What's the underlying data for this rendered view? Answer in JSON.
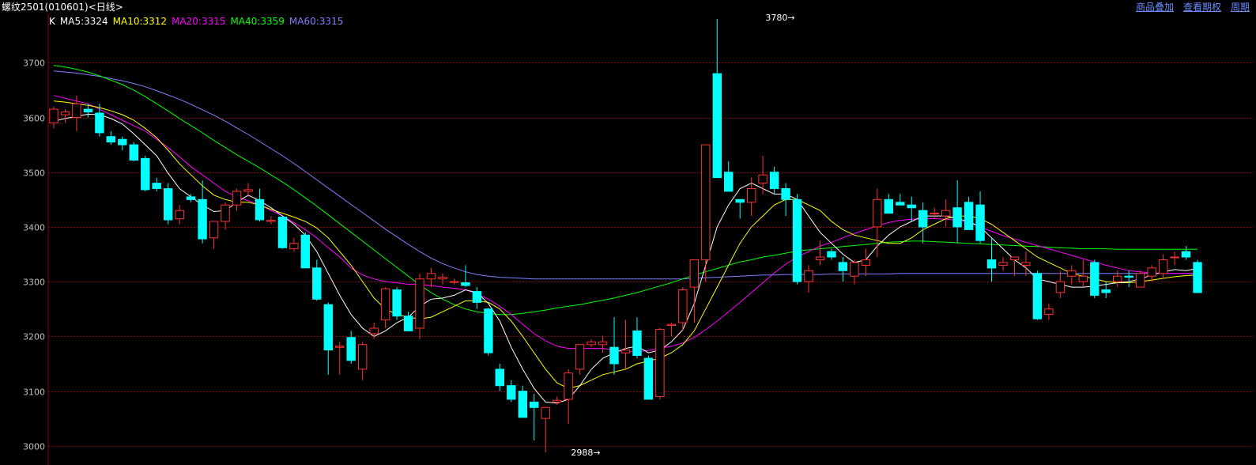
{
  "header": {
    "title": "螺纹2501(010601)<日线>",
    "links": [
      "商品叠加",
      "查看期权",
      "周期"
    ]
  },
  "legend": {
    "k_label": "K",
    "ma5": "MA5:3324",
    "ma10": "MA10:3312",
    "ma20": "MA20:3315",
    "ma40": "MA40:3359",
    "ma60": "MA60:3315"
  },
  "colors": {
    "up": "#ff3232",
    "down": "#00ffff",
    "ma5": "#ffffff",
    "ma10": "#ffff00",
    "ma20": "#ff00ff",
    "ma40": "#00ff00",
    "ma60": "#8080ff",
    "grid": "#8b0000",
    "axis_text": "#c0c0c0"
  },
  "chart_data": {
    "type": "candlestick",
    "ylim": [
      2965,
      3790
    ],
    "yticks": [
      3000,
      3100,
      3200,
      3300,
      3400,
      3500,
      3600,
      3700
    ],
    "grid": true,
    "annotations": [
      {
        "label": "3780→",
        "bar": 65,
        "value": 3780,
        "kind": "high"
      },
      {
        "label": "2988→",
        "bar": 48,
        "value": 2988,
        "kind": "low"
      }
    ],
    "candles": [
      [
        3590,
        3620,
        3580,
        3615
      ],
      [
        3605,
        3615,
        3590,
        3610
      ],
      [
        3600,
        3640,
        3575,
        3625
      ],
      [
        3615,
        3625,
        3600,
        3610
      ],
      [
        3608,
        3625,
        3565,
        3572
      ],
      [
        3565,
        3575,
        3550,
        3555
      ],
      [
        3560,
        3565,
        3540,
        3550
      ],
      [
        3550,
        3555,
        3520,
        3522
      ],
      [
        3525,
        3530,
        3465,
        3468
      ],
      [
        3480,
        3490,
        3465,
        3470
      ],
      [
        3470,
        3480,
        3405,
        3413
      ],
      [
        3415,
        3440,
        3405,
        3430
      ],
      [
        3455,
        3460,
        3445,
        3450
      ],
      [
        3450,
        3485,
        3370,
        3378
      ],
      [
        3380,
        3410,
        3360,
        3410
      ],
      [
        3410,
        3445,
        3395,
        3440
      ],
      [
        3440,
        3470,
        3430,
        3465
      ],
      [
        3465,
        3480,
        3455,
        3468
      ],
      [
        3450,
        3470,
        3410,
        3413
      ],
      [
        3410,
        3420,
        3405,
        3412
      ],
      [
        3418,
        3420,
        3360,
        3362
      ],
      [
        3360,
        3380,
        3355,
        3370
      ],
      [
        3385,
        3390,
        3325,
        3325
      ],
      [
        3325,
        3340,
        3265,
        3268
      ],
      [
        3258,
        3262,
        3130,
        3175
      ],
      [
        3180,
        3190,
        3130,
        3182
      ],
      [
        3198,
        3210,
        3150,
        3156
      ],
      [
        3140,
        3190,
        3120,
        3185
      ],
      [
        3205,
        3225,
        3195,
        3215
      ],
      [
        3230,
        3290,
        3215,
        3287
      ],
      [
        3285,
        3290,
        3230,
        3237
      ],
      [
        3237,
        3245,
        3210,
        3210
      ],
      [
        3215,
        3315,
        3195,
        3305
      ],
      [
        3305,
        3325,
        3290,
        3315
      ],
      [
        3305,
        3315,
        3295,
        3308
      ],
      [
        3300,
        3305,
        3295,
        3300
      ],
      [
        3298,
        3330,
        3290,
        3293
      ],
      [
        3282,
        3290,
        3250,
        3262
      ],
      [
        3250,
        3252,
        3165,
        3170
      ],
      [
        3140,
        3150,
        3100,
        3110
      ],
      [
        3110,
        3120,
        3080,
        3085
      ],
      [
        3100,
        3110,
        3055,
        3052
      ],
      [
        3080,
        3095,
        3010,
        3070
      ],
      [
        3050,
        3070,
        2988,
        3070
      ],
      [
        3080,
        3090,
        3075,
        3083
      ],
      [
        3085,
        3140,
        3040,
        3133
      ],
      [
        3140,
        3185,
        3130,
        3185
      ],
      [
        3185,
        3195,
        3180,
        3190
      ],
      [
        3185,
        3200,
        3170,
        3190
      ],
      [
        3180,
        3235,
        3130,
        3150
      ],
      [
        3170,
        3230,
        3140,
        3175
      ],
      [
        3210,
        3235,
        3160,
        3165
      ],
      [
        3160,
        3165,
        3085,
        3085
      ],
      [
        3090,
        3215,
        3085,
        3213
      ],
      [
        3220,
        3225,
        3200,
        3222
      ],
      [
        3225,
        3290,
        3210,
        3285
      ],
      [
        3290,
        3330,
        3225,
        3340
      ],
      [
        3340,
        3550,
        3300,
        3550
      ],
      [
        3680,
        3780,
        3490,
        3490
      ],
      [
        3500,
        3520,
        3465,
        3465
      ],
      [
        3450,
        3445,
        3415,
        3445
      ],
      [
        3445,
        3490,
        3420,
        3470
      ],
      [
        3480,
        3530,
        3460,
        3495
      ],
      [
        3500,
        3510,
        3460,
        3470
      ],
      [
        3470,
        3480,
        3420,
        3450
      ],
      [
        3450,
        3460,
        3295,
        3300
      ],
      [
        3300,
        3330,
        3280,
        3320
      ],
      [
        3340,
        3375,
        3330,
        3345
      ],
      [
        3355,
        3360,
        3340,
        3345
      ],
      [
        3335,
        3345,
        3300,
        3320
      ],
      [
        3310,
        3340,
        3295,
        3335
      ],
      [
        3330,
        3360,
        3310,
        3340
      ],
      [
        3400,
        3470,
        3345,
        3450
      ],
      [
        3450,
        3460,
        3425,
        3425
      ],
      [
        3445,
        3460,
        3440,
        3440
      ],
      [
        3440,
        3455,
        3410,
        3435
      ],
      [
        3430,
        3445,
        3370,
        3400
      ],
      [
        3425,
        3435,
        3415,
        3425
      ],
      [
        3420,
        3450,
        3400,
        3430
      ],
      [
        3435,
        3485,
        3370,
        3400
      ],
      [
        3445,
        3455,
        3395,
        3395
      ],
      [
        3440,
        3465,
        3370,
        3375
      ],
      [
        3340,
        3380,
        3300,
        3325
      ],
      [
        3330,
        3345,
        3320,
        3335
      ],
      [
        3340,
        3345,
        3310,
        3345
      ],
      [
        3330,
        3355,
        3310,
        3335
      ],
      [
        3315,
        3320,
        3230,
        3232
      ],
      [
        3240,
        3260,
        3230,
        3250
      ],
      [
        3280,
        3320,
        3270,
        3300
      ],
      [
        3310,
        3330,
        3295,
        3320
      ],
      [
        3300,
        3340,
        3290,
        3310
      ],
      [
        3335,
        3340,
        3270,
        3275
      ],
      [
        3285,
        3300,
        3270,
        3280
      ],
      [
        3300,
        3320,
        3290,
        3310
      ],
      [
        3310,
        3320,
        3290,
        3308
      ],
      [
        3290,
        3320,
        3290,
        3315
      ],
      [
        3310,
        3330,
        3300,
        3325
      ],
      [
        3315,
        3350,
        3305,
        3340
      ],
      [
        3345,
        3355,
        3330,
        3345
      ],
      [
        3355,
        3365,
        3340,
        3345
      ],
      [
        3335,
        3340,
        3285,
        3280
      ]
    ],
    "ma": {
      "ma5": [
        3593,
        3598,
        3602,
        3606,
        3605,
        3598,
        3588,
        3570,
        3550,
        3530,
        3498,
        3470,
        3455,
        3440,
        3428,
        3430,
        3445,
        3458,
        3448,
        3435,
        3420,
        3405,
        3385,
        3355,
        3315,
        3275,
        3240,
        3215,
        3200,
        3210,
        3225,
        3235,
        3255,
        3268,
        3270,
        3275,
        3285,
        3280,
        3260,
        3228,
        3180,
        3140,
        3105,
        3080,
        3078,
        3085,
        3110,
        3140,
        3160,
        3170,
        3178,
        3182,
        3170,
        3175,
        3190,
        3212,
        3260,
        3330,
        3400,
        3440,
        3470,
        3480,
        3470,
        3460,
        3460,
        3450,
        3420,
        3390,
        3370,
        3350,
        3335,
        3340,
        3365,
        3385,
        3400,
        3410,
        3420,
        3420,
        3420,
        3415,
        3410,
        3400,
        3380,
        3360,
        3340,
        3325,
        3305,
        3300,
        3295,
        3290,
        3290,
        3292,
        3295,
        3298,
        3300,
        3305,
        3312,
        3318,
        3322,
        3320,
        3324
      ],
      "ma10": [
        3630,
        3628,
        3625,
        3622,
        3618,
        3612,
        3605,
        3595,
        3580,
        3563,
        3540,
        3515,
        3495,
        3475,
        3458,
        3450,
        3445,
        3445,
        3440,
        3432,
        3425,
        3418,
        3410,
        3398,
        3380,
        3355,
        3330,
        3300,
        3270,
        3250,
        3240,
        3235,
        3232,
        3235,
        3245,
        3255,
        3265,
        3265,
        3262,
        3250,
        3228,
        3200,
        3170,
        3140,
        3115,
        3105,
        3110,
        3120,
        3130,
        3135,
        3140,
        3150,
        3155,
        3160,
        3170,
        3185,
        3210,
        3250,
        3290,
        3330,
        3370,
        3400,
        3420,
        3440,
        3450,
        3450,
        3440,
        3430,
        3410,
        3395,
        3385,
        3380,
        3375,
        3370,
        3370,
        3380,
        3395,
        3405,
        3415,
        3420,
        3420,
        3415,
        3405,
        3390,
        3375,
        3360,
        3345,
        3335,
        3325,
        3315,
        3310,
        3305,
        3300,
        3298,
        3298,
        3300,
        3303,
        3306,
        3309,
        3311,
        3312
      ],
      "ma20": [
        3640,
        3635,
        3630,
        3625,
        3615,
        3605,
        3595,
        3585,
        3575,
        3560,
        3545,
        3528,
        3510,
        3495,
        3480,
        3465,
        3455,
        3448,
        3440,
        3430,
        3420,
        3408,
        3395,
        3380,
        3362,
        3345,
        3325,
        3312,
        3305,
        3300,
        3298,
        3295,
        3295,
        3293,
        3290,
        3288,
        3285,
        3278,
        3268,
        3255,
        3240,
        3222,
        3205,
        3192,
        3182,
        3178,
        3178,
        3178,
        3178,
        3175,
        3172,
        3172,
        3174,
        3178,
        3182,
        3188,
        3198,
        3212,
        3228,
        3245,
        3262,
        3280,
        3298,
        3316,
        3332,
        3345,
        3355,
        3365,
        3372,
        3380,
        3388,
        3395,
        3402,
        3408,
        3412,
        3414,
        3415,
        3415,
        3414,
        3412,
        3408,
        3400,
        3392,
        3384,
        3378,
        3372,
        3366,
        3360,
        3354,
        3348,
        3342,
        3336,
        3330,
        3325,
        3320,
        3318,
        3316,
        3315,
        3315,
        3315,
        3315
      ],
      "ma40": [
        3695,
        3692,
        3688,
        3683,
        3676,
        3668,
        3660,
        3650,
        3638,
        3625,
        3612,
        3598,
        3585,
        3572,
        3558,
        3545,
        3532,
        3520,
        3508,
        3495,
        3482,
        3468,
        3453,
        3438,
        3422,
        3406,
        3390,
        3374,
        3358,
        3342,
        3326,
        3310,
        3294,
        3280,
        3268,
        3258,
        3250,
        3245,
        3242,
        3240,
        3240,
        3242,
        3245,
        3248,
        3252,
        3255,
        3258,
        3262,
        3266,
        3270,
        3275,
        3280,
        3286,
        3292,
        3298,
        3305,
        3312,
        3318,
        3324,
        3330,
        3336,
        3340,
        3345,
        3348,
        3352,
        3356,
        3358,
        3360,
        3362,
        3364,
        3366,
        3368,
        3370,
        3372,
        3373,
        3374,
        3374,
        3373,
        3372,
        3371,
        3370,
        3369,
        3368,
        3367,
        3366,
        3365,
        3364,
        3363,
        3362,
        3361,
        3360,
        3360,
        3360,
        3359,
        3359,
        3359,
        3359,
        3359,
        3359,
        3359,
        3359
      ],
      "ma60": [
        3685,
        3683,
        3681,
        3678,
        3675,
        3671,
        3667,
        3662,
        3656,
        3649,
        3641,
        3633,
        3624,
        3614,
        3604,
        3593,
        3581,
        3569,
        3556,
        3543,
        3530,
        3516,
        3501,
        3486,
        3471,
        3456,
        3441,
        3426,
        3411,
        3396,
        3382,
        3368,
        3355,
        3343,
        3333,
        3325,
        3318,
        3313,
        3310,
        3308,
        3307,
        3306,
        3305,
        3305,
        3305,
        3305,
        3305,
        3305,
        3305,
        3305,
        3305,
        3305,
        3305,
        3305,
        3305,
        3305,
        3306,
        3307,
        3308,
        3309,
        3310,
        3311,
        3312,
        3312,
        3313,
        3313,
        3313,
        3313,
        3314,
        3314,
        3314,
        3314,
        3314,
        3314,
        3315,
        3315,
        3315,
        3315,
        3315,
        3315,
        3315,
        3315,
        3315,
        3315,
        3315,
        3315,
        3315,
        3315,
        3315,
        3315,
        3315,
        3315,
        3315,
        3315,
        3315,
        3315,
        3315,
        3315,
        3315,
        3315,
        3315
      ]
    }
  }
}
